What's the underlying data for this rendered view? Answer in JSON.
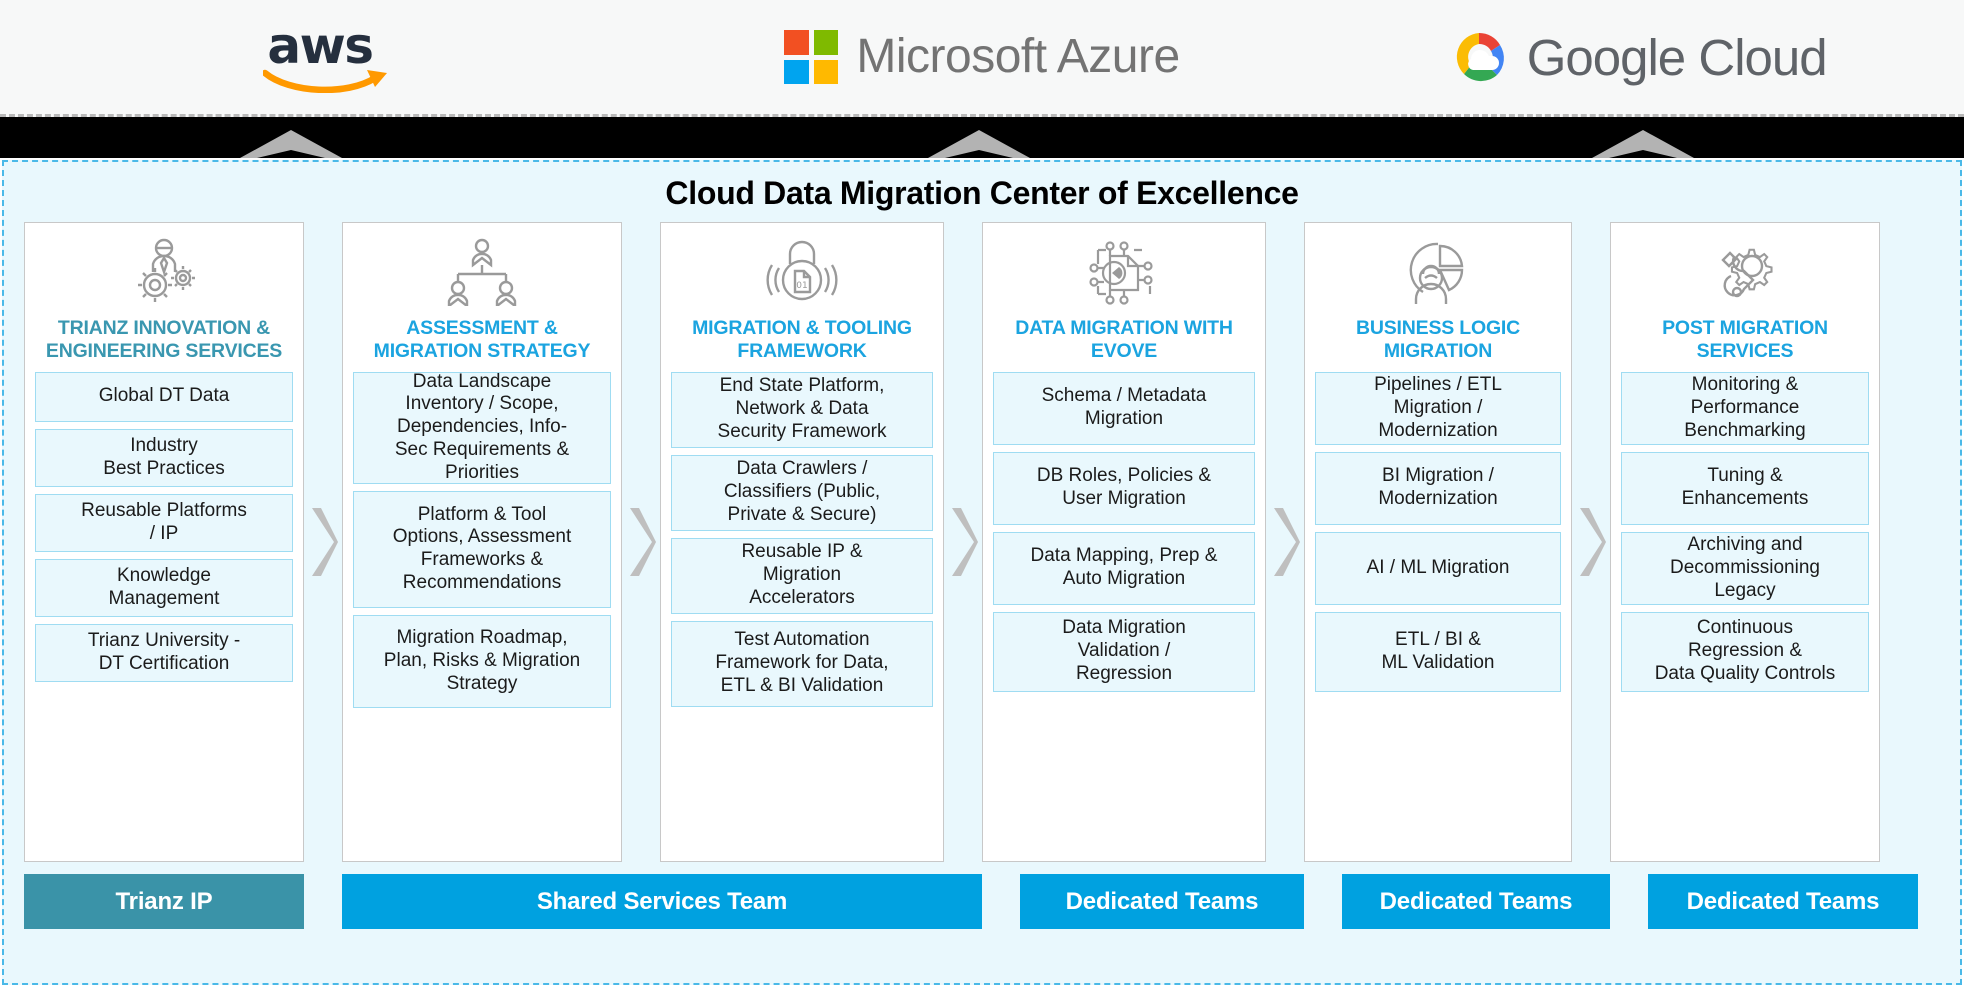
{
  "top_bar": {
    "logos": [
      {
        "name": "aws-logo",
        "text": "aws",
        "colors": {
          "word": "#252f3e",
          "smile": "#ff9900"
        }
      },
      {
        "name": "microsoft-azure-logo",
        "text": "Microsoft Azure",
        "colors": {
          "red": "#f25022",
          "green": "#7fba00",
          "blue": "#00a4ef",
          "yellow": "#ffb900",
          "word": "#737373"
        }
      },
      {
        "name": "google-cloud-logo",
        "text_bold": "Google",
        "text_thin": "Cloud",
        "colors": {
          "red": "#ea4335",
          "blue": "#4285f4",
          "yellow": "#fbbc04",
          "green": "#34a853",
          "word": "#5f6368"
        }
      }
    ]
  },
  "band": {
    "chevron_color": "#b3b3b3",
    "background": "#000000",
    "chevron_count": 3
  },
  "main": {
    "title": "Cloud Data Migration Center of Excellence",
    "background": "#e9f8fd",
    "border_color": "#4ab9e8",
    "columns": [
      {
        "id": "trianz-innovation",
        "icon": "person-gears-icon",
        "title": "TRIANZ INNOVATION &\nENGINEERING SERVICES",
        "title_color": "#3a97b0",
        "items": [
          "Global DT Data",
          "Industry\nBest Practices",
          "Reusable Platforms\n/ IP",
          "Knowledge\nManagement",
          "Trianz University -\nDT Certification"
        ]
      },
      {
        "id": "assessment-migration-strategy",
        "icon": "org-chart-people-icon",
        "title": "ASSESSMENT &\nMIGRATION STRATEGY",
        "title_color": "#1ba4e0",
        "items": [
          "Data Landscape\nInventory / Scope,\nDependencies, Info-\nSec Requirements &\nPriorities",
          "Platform & Tool\nOptions, Assessment\nFrameworks &\nRecommendations",
          "Migration Roadmap,\nPlan, Risks & Migration\nStrategy"
        ]
      },
      {
        "id": "migration-tooling-framework",
        "icon": "padlock-data-icon",
        "title": "MIGRATION & TOOLING\nFRAMEWORK",
        "title_color": "#1ba4e0",
        "items": [
          "End State Platform,\nNetwork & Data\nSecurity Framework",
          "Data Crawlers /\nClassifiers (Public,\nPrivate & Secure)",
          "Reusable IP &\nMigration\nAccelerators",
          "Test Automation\nFramework for Data,\nETL & BI Validation"
        ]
      },
      {
        "id": "data-migration-with-evove",
        "icon": "circuit-chip-document-icon",
        "title": "DATA MIGRATION WITH\nEVOVE",
        "title_color": "#1ba4e0",
        "items": [
          "Schema / Metadata\nMigration",
          "DB Roles, Policies &\nUser Migration",
          "Data Mapping, Prep &\nAuto Migration",
          "Data Migration\nValidation /\nRegression"
        ]
      },
      {
        "id": "business-logic-migration",
        "icon": "pie-chart-person-icon",
        "title": "BUSINESS LOGIC\nMIGRATION",
        "title_color": "#1ba4e0",
        "items": [
          "Pipelines / ETL\nMigration /\nModernization",
          "BI Migration /\nModernization",
          "AI / ML Migration",
          "ETL / BI &\nML Validation"
        ]
      },
      {
        "id": "post-migration-services",
        "icon": "wrench-gear-icon",
        "title": "POST MIGRATION\nSERVICES",
        "title_color": "#1ba4e0",
        "items": [
          "Monitoring &\nPerformance\nBenchmarking",
          "Tuning &\nEnhancements",
          "Archiving and\nDecommissioning\nLegacy",
          "Continuous\nRegression &\nData Quality Controls"
        ]
      }
    ],
    "separator_icon": "chevron-right-icon",
    "separator_color": "#bfbfbf",
    "footers": [
      {
        "label": "Trianz IP",
        "color": "#3a93a8",
        "span": 1
      },
      {
        "label": "Shared Services Team",
        "color": "#00a1e0",
        "span": 2
      },
      {
        "label": "Dedicated Teams",
        "color": "#00a1e0",
        "span": 1
      },
      {
        "label": "Dedicated Teams",
        "color": "#00a1e0",
        "span": 1
      },
      {
        "label": "Dedicated Teams",
        "color": "#00a1e0",
        "span": 1
      }
    ]
  }
}
